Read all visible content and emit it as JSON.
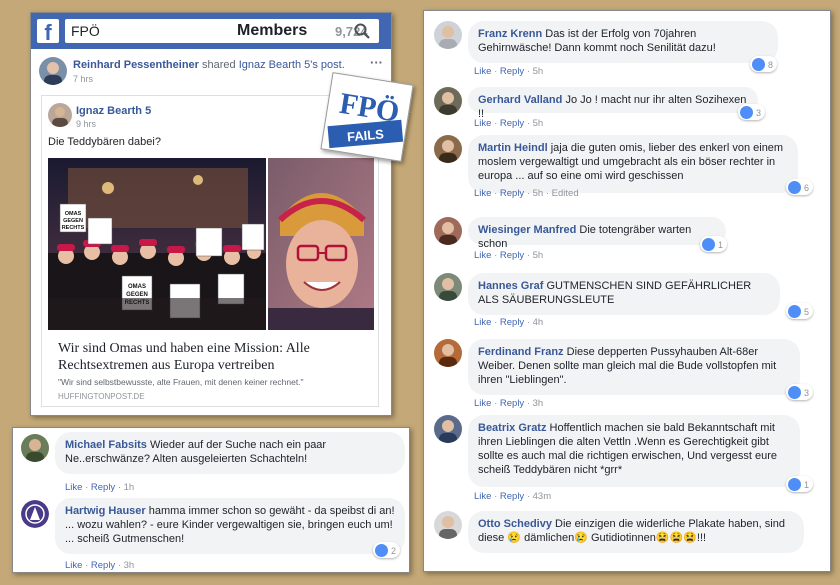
{
  "header": {
    "search_query": "FPÖ",
    "members_label": "Members",
    "members_count": "9,724"
  },
  "post": {
    "sharer_name": "Reinhard Pessentheiner",
    "shared_text": "shared",
    "shared_link": "Ignaz Bearth 5's post.",
    "time": "7 hrs",
    "more": "···",
    "inner": {
      "author": "Ignaz Bearth 5",
      "time": "9 hrs",
      "text": "Die Teddybären dabei?",
      "sign_text": [
        "OMAS",
        "GEGEN",
        "RECHTS"
      ],
      "link_title": "Wir sind Omas und haben eine Mission: Alle Rechtsextremen aus Europa vertreiben",
      "link_desc": "\"Wir sind selbstbewusste, alte Frauen, mit denen keiner rechnet.\"",
      "link_source": "HUFFINGTONPOST.DE"
    }
  },
  "badge": {
    "top": "FPÖ",
    "bottom": "FAILS",
    "colors": {
      "blue": "#2b5eb0",
      "gold": "#f2b705"
    }
  },
  "actions": {
    "like": "Like",
    "reply": "Reply",
    "sep": "·"
  },
  "comments_left": [
    {
      "name": "Michael Fabsits",
      "text": "Wieder auf der Suche nach ein paar Ne..erschwänze? Alten ausgeleierten Schachteln!",
      "time": "1h",
      "reactions": ""
    },
    {
      "name": "Hartwig Hauser",
      "text": "hamma immer schon so gewäht - da speibst di an! ... wozu wahlen? - eure Kinder vergewaltigen sie, bringen euch um! ... scheiß Gutmenschen!",
      "time": "3h",
      "reactions": "2"
    }
  ],
  "comments_right": [
    {
      "name": "Franz Krenn",
      "text": "Das ist der Erfolg von 70jahren Gehirnwäsche! Dann kommt noch Senilität dazu!",
      "time": "5h",
      "reactions": "8",
      "edited": ""
    },
    {
      "name": "Gerhard Valland",
      "text": "Jo Jo ! macht nur ihr alten Sozihexen !!",
      "time": "5h",
      "reactions": "3",
      "edited": ""
    },
    {
      "name": "Martin Heindl",
      "text": "jaja die guten omis, lieber des enkerl von einem moslem vergewaltigt und umgebracht als ein böser rechter in europa ... auf so eine omi wird geschissen",
      "time": "5h",
      "reactions": "6",
      "edited": "Edited"
    },
    {
      "name": "Wiesinger Manfred",
      "text": "Die totengräber warten schon",
      "time": "5h",
      "reactions": "1",
      "edited": ""
    },
    {
      "name": "Hannes Graf",
      "text": "GUTMENSCHEN SIND GEFÄHRLICHER ALS SÄUBERUNGSLEUTE",
      "time": "4h",
      "reactions": "5",
      "edited": ""
    },
    {
      "name": "Ferdinand Franz",
      "text": "Diese depperten Pussyhauben Alt-68er Weiber. Denen sollte man gleich mal die Bude vollstopfen mit ihren \"Lieblingen\".",
      "time": "3h",
      "reactions": "3",
      "edited": ""
    },
    {
      "name": "Beatrix Gratz",
      "text": "Hoffentlich machen sie bald Bekanntschaft mit ihren Lieblingen die alten Vettln .Wenn es Gerechtigkeit gibt sollte es auch mal die richtigen erwischen, Und vergesst eure scheiß Teddybären nicht *grr*",
      "time": "43m",
      "reactions": "1",
      "edited": ""
    },
    {
      "name": "Otto Schedivy",
      "text": "Die einzigen die widerliche Plakate haben, sind diese 😢 dämlichen😢 Gutidiotinnen😫😫😫!!!",
      "time": "",
      "reactions": "",
      "edited": ""
    }
  ]
}
